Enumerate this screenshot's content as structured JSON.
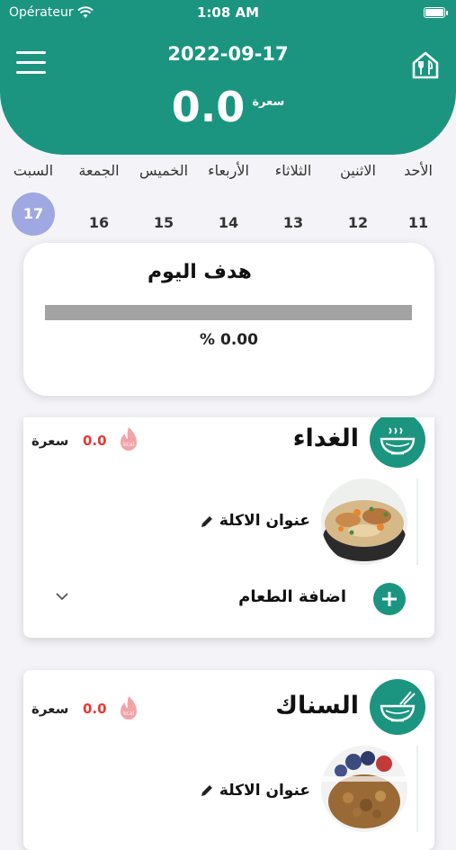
{
  "status": {
    "carrier": "Opérateur",
    "time": "1:08 AM"
  },
  "header": {
    "date": "2022-09-17",
    "calories": "0.0",
    "unit": "سعرة"
  },
  "days": [
    {
      "name": "الأحد",
      "num": "11"
    },
    {
      "name": "الاثنين",
      "num": "12"
    },
    {
      "name": "الثلاثاء",
      "num": "13"
    },
    {
      "name": "الأربعاء",
      "num": "14"
    },
    {
      "name": "الخميس",
      "num": "15"
    },
    {
      "name": "الجمعة",
      "num": "16"
    },
    {
      "name": "السبت",
      "num": "17"
    }
  ],
  "goal": {
    "title": "هدف اليوم",
    "progress": 0.0,
    "percent_text": "% 0.00"
  },
  "lunch": {
    "title": "الغداء",
    "kcal": "0.0",
    "kcal_unit": "سعرة",
    "kcal_icon": "kcal-flame-icon",
    "food_title": "عنوان الاكلة",
    "add_label": "اضافة الطعام"
  },
  "snack": {
    "title": "السناك",
    "kcal": "0.0",
    "kcal_unit": "سعرة",
    "food_title": "عنوان الاكلة"
  },
  "colors": {
    "primary": "#1b9580",
    "active_day": "#9fa8e0",
    "kcal": "#e53935"
  }
}
